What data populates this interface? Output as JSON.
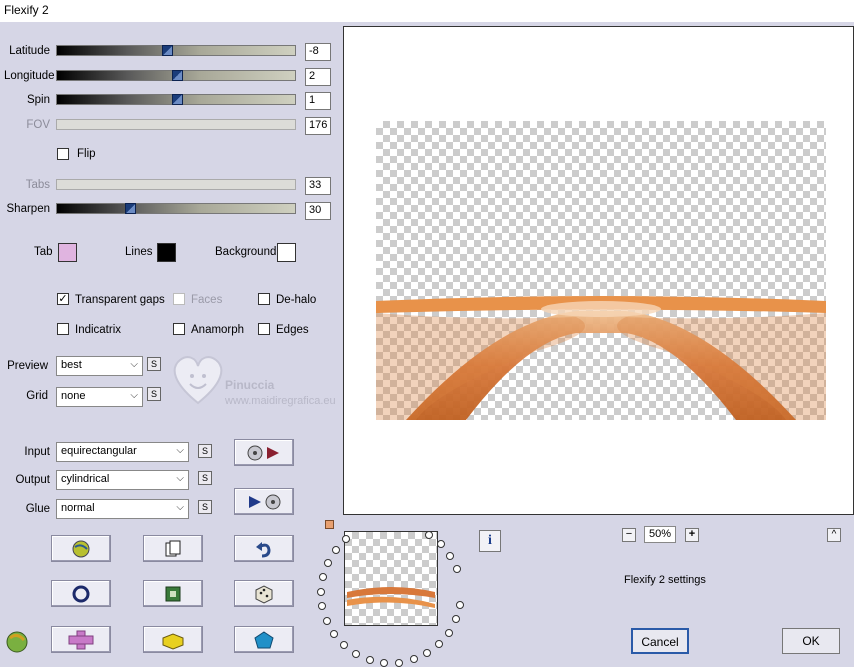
{
  "window": {
    "title": "Flexify 2"
  },
  "sliders": [
    {
      "label": "Latitude",
      "value": "-8",
      "level": 0.46,
      "enabled": true
    },
    {
      "label": "Longitude",
      "value": "2",
      "level": 0.5,
      "enabled": true
    },
    {
      "label": "Spin",
      "value": "1",
      "level": 0.5,
      "enabled": true
    },
    {
      "label": "FOV",
      "value": "176",
      "level": 0.0,
      "enabled": false
    },
    {
      "label": "Tabs",
      "value": "33",
      "level": 0.0,
      "enabled": false
    },
    {
      "label": "Sharpen",
      "value": "30",
      "level": 0.31,
      "enabled": true
    }
  ],
  "flip": {
    "label": "Flip",
    "checked": false
  },
  "colors": {
    "tab": {
      "label": "Tab",
      "color": "#e0b4e0"
    },
    "lines": {
      "label": "Lines",
      "color": "#000000"
    },
    "background": {
      "label": "Background",
      "color": "#ffffff"
    }
  },
  "options": {
    "transparent_gaps": {
      "label": "Transparent gaps",
      "checked": true
    },
    "faces": {
      "label": "Faces",
      "checked": false
    },
    "de_halo": {
      "label": "De-halo",
      "checked": false
    },
    "indicatrix": {
      "label": "Indicatrix",
      "checked": false
    },
    "anamorph": {
      "label": "Anamorph",
      "checked": false
    },
    "edges": {
      "label": "Edges",
      "checked": false
    }
  },
  "preview_select": {
    "label": "Preview",
    "value": "best"
  },
  "grid_select": {
    "label": "Grid",
    "value": "none"
  },
  "input_select": {
    "label": "Input",
    "value": "equirectangular"
  },
  "output_select": {
    "label": "Output",
    "value": "cylindrical"
  },
  "glue_select": {
    "label": "Glue",
    "value": "normal"
  },
  "s_label": "S",
  "watermark": {
    "name": "Pinuccia",
    "url": "www.maidiregrafica.eu"
  },
  "zoom": {
    "minus": "−",
    "value": "50%",
    "plus": "+"
  },
  "info_icon": "i",
  "settings_text": "Flexify 2 settings",
  "collapse": "^",
  "buttons": {
    "cancel": "Cancel",
    "ok": "OK"
  }
}
